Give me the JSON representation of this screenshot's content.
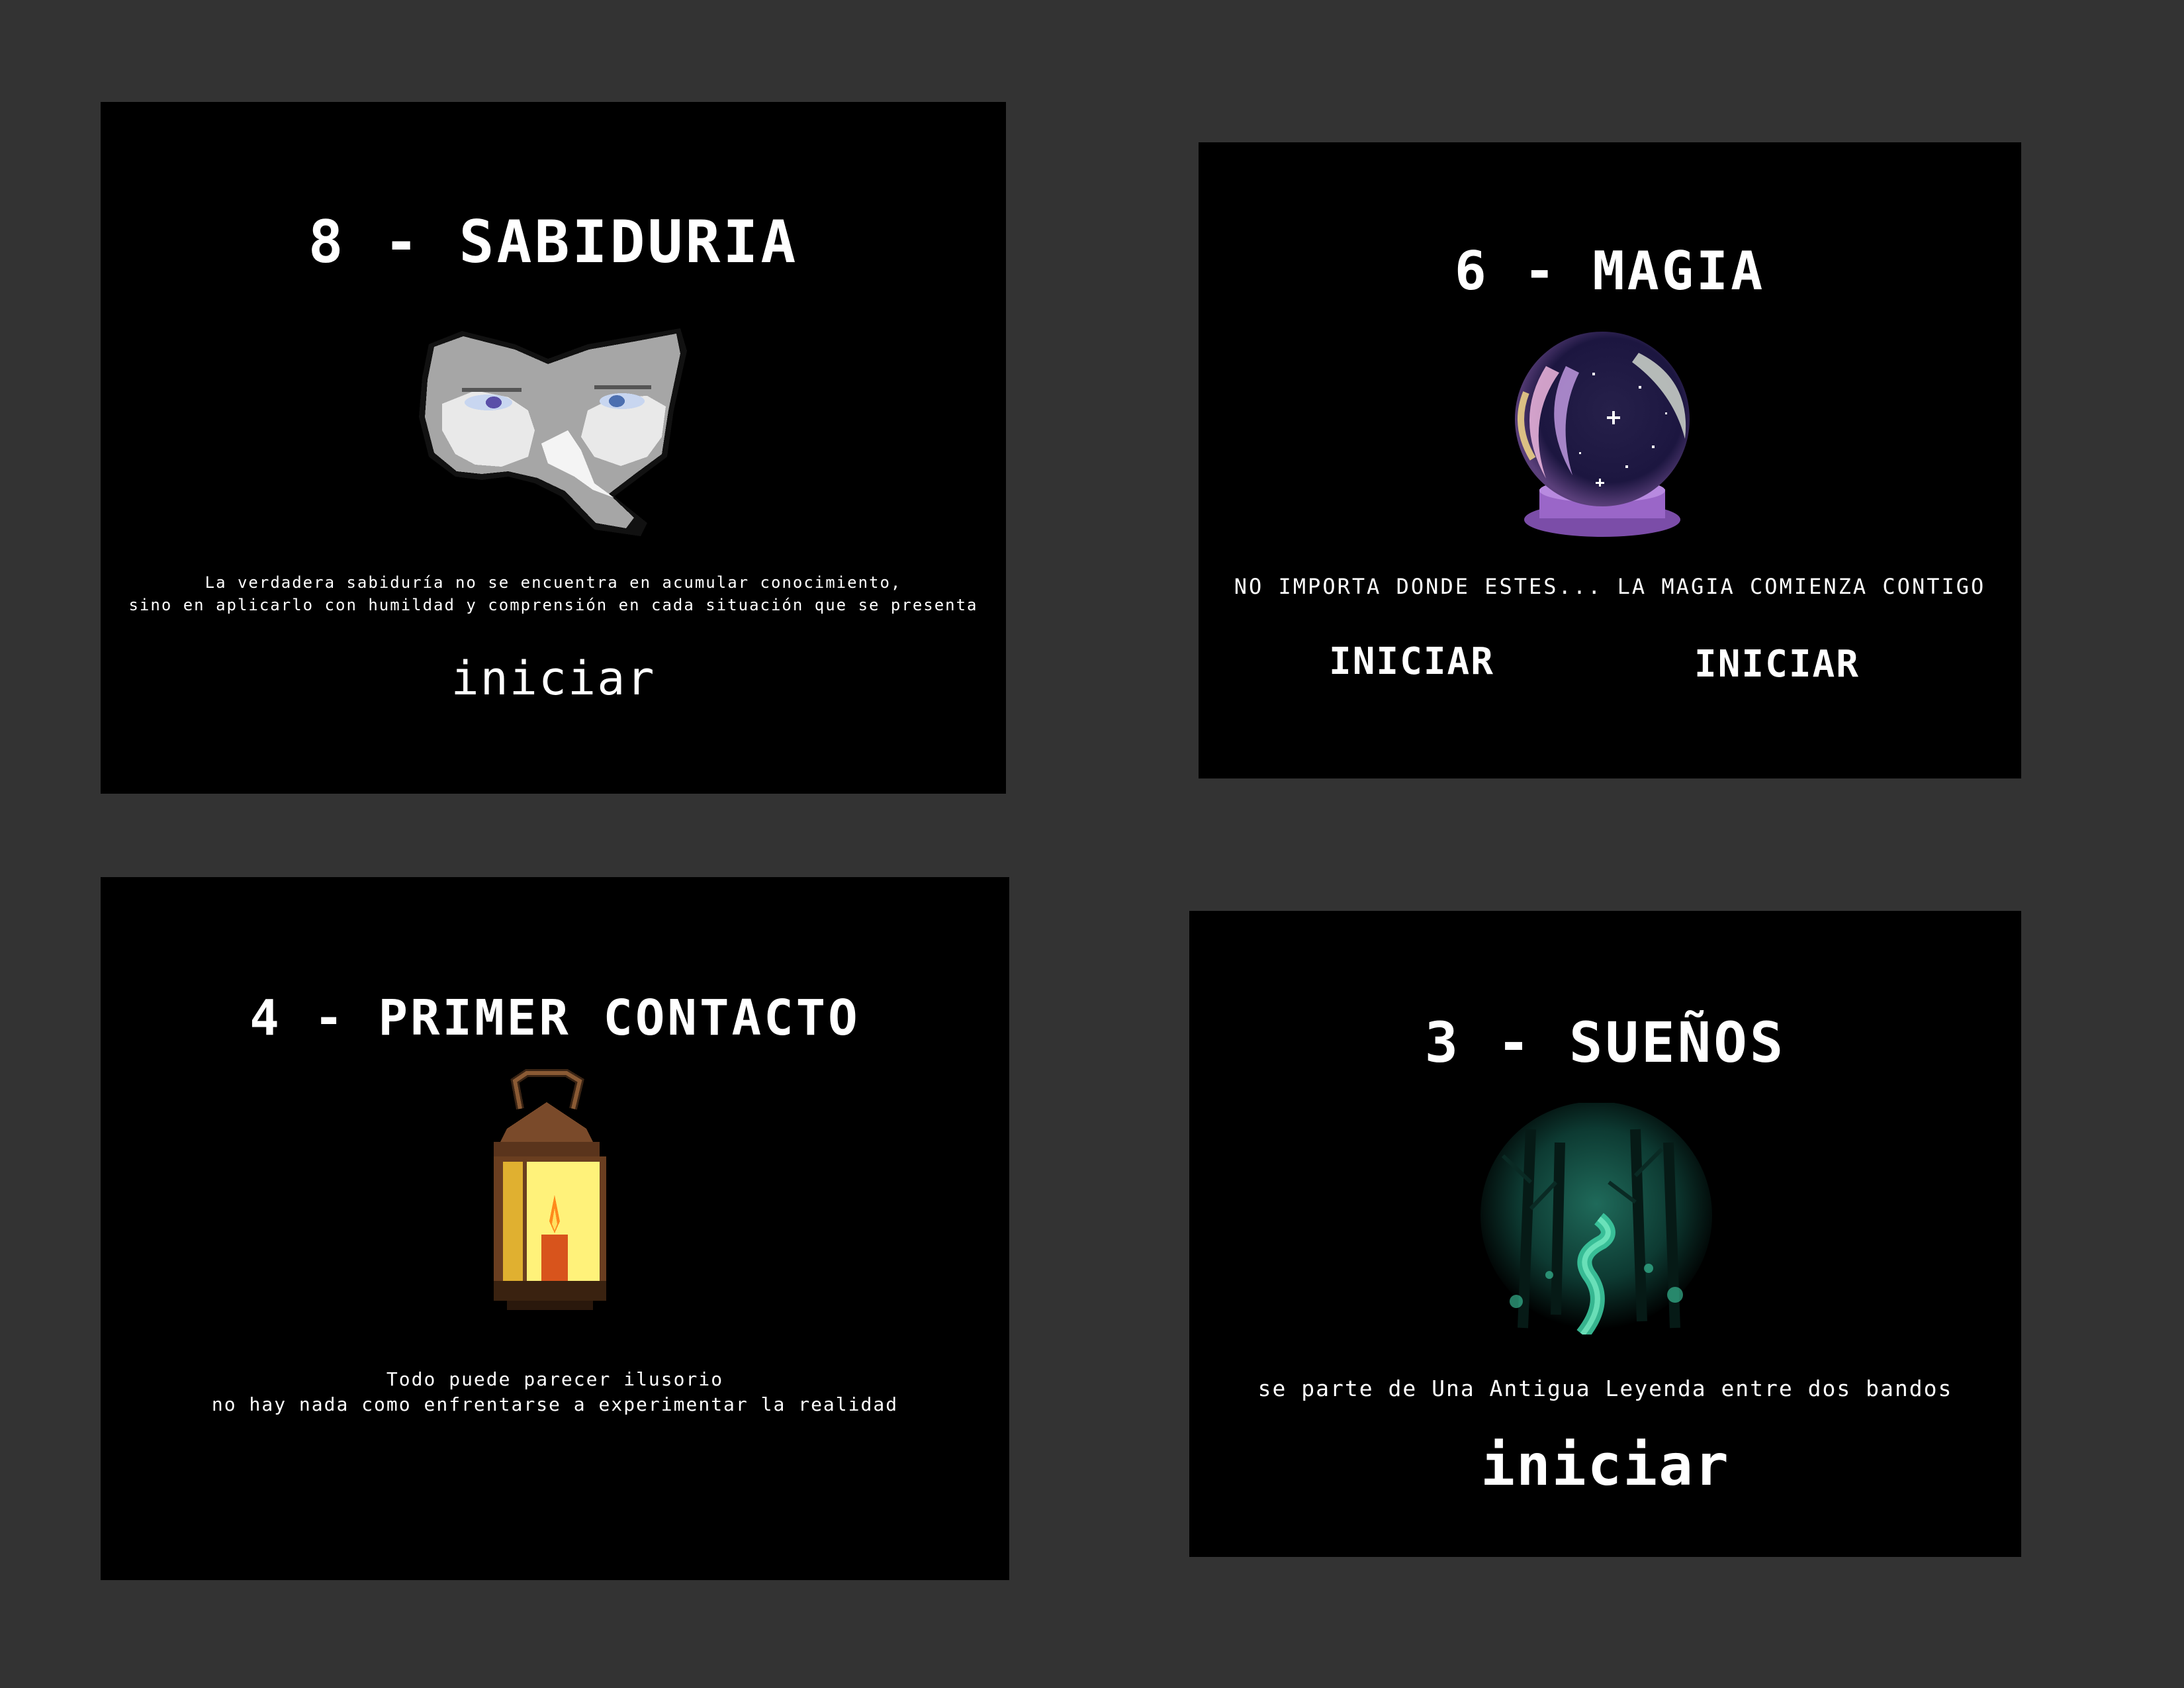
{
  "cards": [
    {
      "title": "8 - SABIDURIA",
      "icon": "mask-icon",
      "description_lines": [
        "La verdadera sabiduría no se encuentra en acumular conocimiento,",
        "sino en aplicarlo con humildad y comprensión en cada situación que se presenta"
      ],
      "buttons": [
        "iniciar"
      ]
    },
    {
      "title": "6 - MAGIA",
      "icon": "crystal-ball-icon",
      "description_lines": [
        "NO IMPORTA DONDE ESTES... LA MAGIA COMIENZA CONTIGO"
      ],
      "buttons": [
        "INICIAR",
        "INICIAR"
      ]
    },
    {
      "title": "4 - PRIMER CONTACTO",
      "icon": "lantern-icon",
      "description_lines": [
        "Todo puede parecer ilusorio",
        "no hay nada como enfrentarse a experimentar la realidad"
      ],
      "buttons": []
    },
    {
      "title": "3 - SUEÑOS",
      "icon": "forest-path-icon",
      "description_lines": [
        "se parte de Una Antigua Leyenda entre dos bandos"
      ],
      "buttons": [
        "iniciar"
      ]
    }
  ],
  "colors": {
    "background": "#333333",
    "card": "#000000",
    "text": "#ffffff",
    "forest_accent": "#3fd1a6",
    "lantern_glow": "#fff27a",
    "ball_base": "#8a55b8"
  }
}
